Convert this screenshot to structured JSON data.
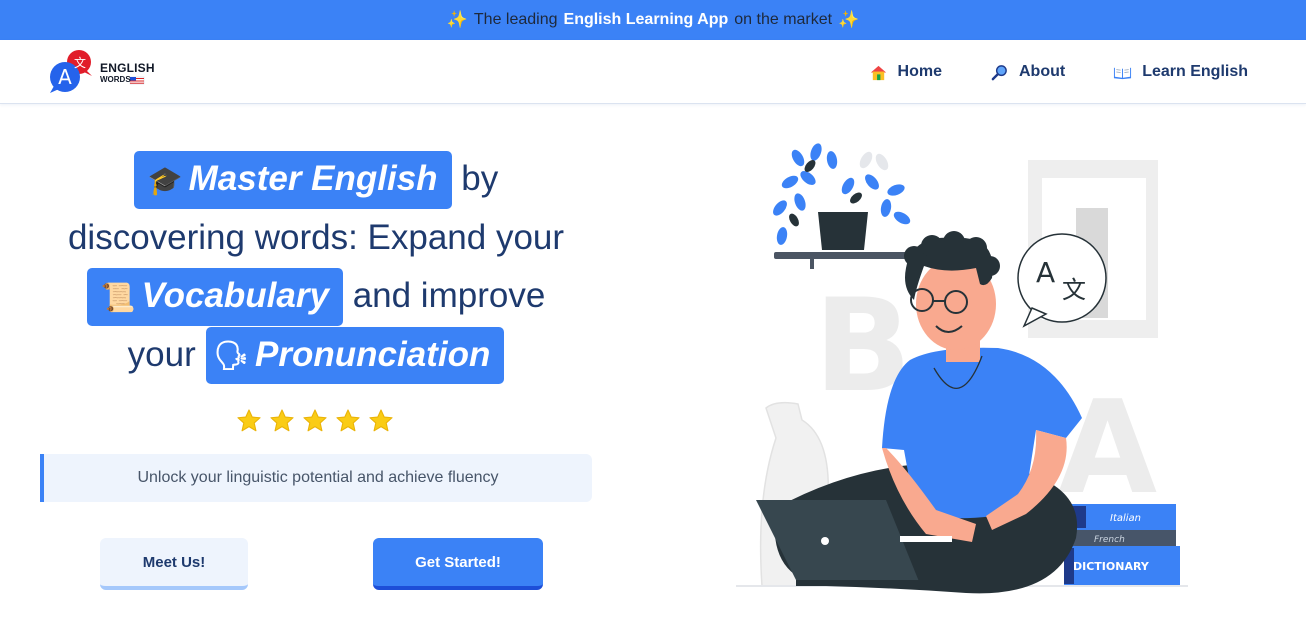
{
  "banner": {
    "prefix": "The leading",
    "highlight": "English Learning App",
    "suffix": "on the market",
    "sparkle_icon": "sparkles-icon"
  },
  "logo": {
    "title": "ENGLISH",
    "subtitle": "WORDS",
    "glyph_a": "A",
    "glyph_cjk": "文"
  },
  "nav": {
    "items": [
      {
        "label": "Home",
        "icon": "house-icon"
      },
      {
        "label": "About",
        "icon": "magnifier-icon"
      },
      {
        "label": "Learn English",
        "icon": "open-book-icon"
      }
    ]
  },
  "hero": {
    "highlight1": "Master English",
    "text1": "by",
    "text2": "discovering words: Expand your",
    "highlight2": "Vocabulary",
    "text3": "and improve",
    "text4": "your",
    "highlight3": "Pronunciation",
    "emoji1": "🎓",
    "emoji2": "📜",
    "emoji3": "🗣",
    "rating_stars": 5
  },
  "subtitle": "Unlock your linguistic potential and achieve fluency",
  "buttons": {
    "meet": "Meet Us!",
    "start": "Get Started!"
  },
  "illustration": {
    "bubble_a": "A",
    "bubble_cjk": "文",
    "book_italian": "Italian",
    "book_french": "French",
    "book_dictionary": "DICTIONARY",
    "letter_b": "B",
    "letter_a": "A"
  },
  "colors": {
    "primary": "#3b82f6",
    "dark_text": "#1e3a6e",
    "soft_bg": "#eef4fd",
    "star": "#facc15"
  }
}
